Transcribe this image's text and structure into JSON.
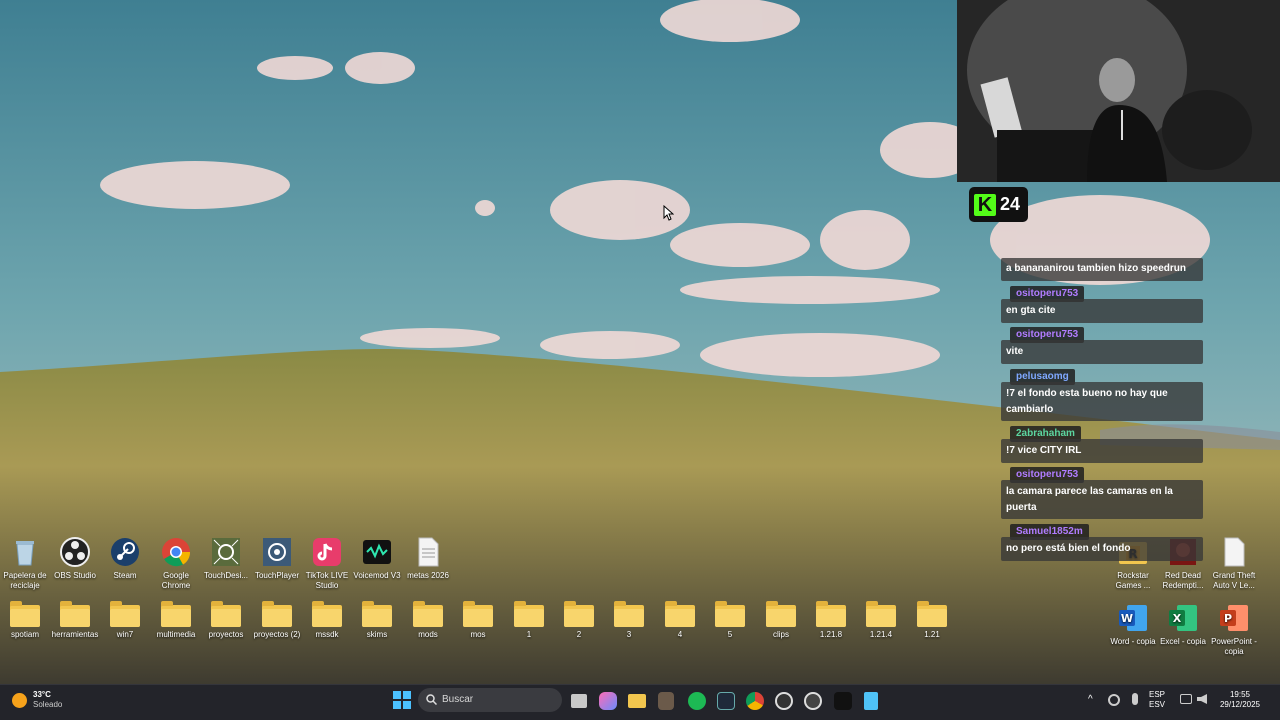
{
  "desktop": {
    "row1": [
      {
        "label": "Papelera de reciclaje",
        "icon": "recycle-bin-icon"
      },
      {
        "label": "OBS Studio",
        "icon": "obs-icon"
      },
      {
        "label": "Steam",
        "icon": "steam-icon"
      },
      {
        "label": "Google Chrome",
        "icon": "chrome-icon"
      },
      {
        "label": "TouchDesi...",
        "icon": "touchdesigner-icon"
      },
      {
        "label": "TouchPlayer",
        "icon": "touchplayer-icon"
      },
      {
        "label": "TikTok LIVE Studio",
        "icon": "tiktok-icon"
      },
      {
        "label": "Voicemod V3",
        "icon": "voicemod-icon"
      },
      {
        "label": "metas 2026",
        "icon": "text-file-icon"
      }
    ],
    "folders": [
      "spotiam",
      "herramientas",
      "win7",
      "multimedia",
      "proyectos",
      "proyectos (2)",
      "mssdk",
      "skims",
      "mods",
      "mos",
      "1",
      "2",
      "3",
      "4",
      "5",
      "clips",
      "1.21.8",
      "1.21.4",
      "1.21"
    ],
    "right_row1": [
      {
        "label": "Rockstar Games ...",
        "icon": "rockstar-folder-icon"
      },
      {
        "label": "Red Dead Redempti...",
        "icon": "red-dead-icon"
      },
      {
        "label": "Grand Theft Auto V Le...",
        "icon": "file-icon"
      }
    ],
    "right_row2": [
      {
        "label": "Word - copia",
        "icon": "word-icon"
      },
      {
        "label": "Excel - copia",
        "icon": "excel-icon"
      },
      {
        "label": "PowerPoint - copia",
        "icon": "powerpoint-icon"
      }
    ]
  },
  "overlay": {
    "kick_logo": "K",
    "viewer_count": "24",
    "chat": [
      {
        "user": "",
        "text": "a banananirou tambien hizo speedrun",
        "color": ""
      },
      {
        "user": "ositoperu753",
        "text": "en gta cite",
        "color": "#b07cff"
      },
      {
        "user": "ositoperu753",
        "text": "vite",
        "color": "#b07cff"
      },
      {
        "user": "pelusaomg",
        "text": "!7 el fondo esta bueno no hay que cambiarlo",
        "color": "#7fa8ff"
      },
      {
        "user": "2abrahaham",
        "text": "!7 vice CITY IRL",
        "color": "#5cd6a0"
      },
      {
        "user": "ositoperu753",
        "text": "la camara parece las camaras en la puerta",
        "color": "#b07cff"
      },
      {
        "user": "Samuel1852m",
        "text": "no pero está bien el fondo",
        "color": "#b07cff"
      }
    ]
  },
  "taskbar": {
    "weather_temp": "33°C",
    "weather_desc": "Soleado",
    "search_placeholder": "Buscar",
    "lang_1": "ESP",
    "lang_2": "ESV",
    "time": "19:55",
    "date": "29/12/2025"
  },
  "colors": {
    "taskbar": "#23242a",
    "kick_green": "#53fc18"
  }
}
